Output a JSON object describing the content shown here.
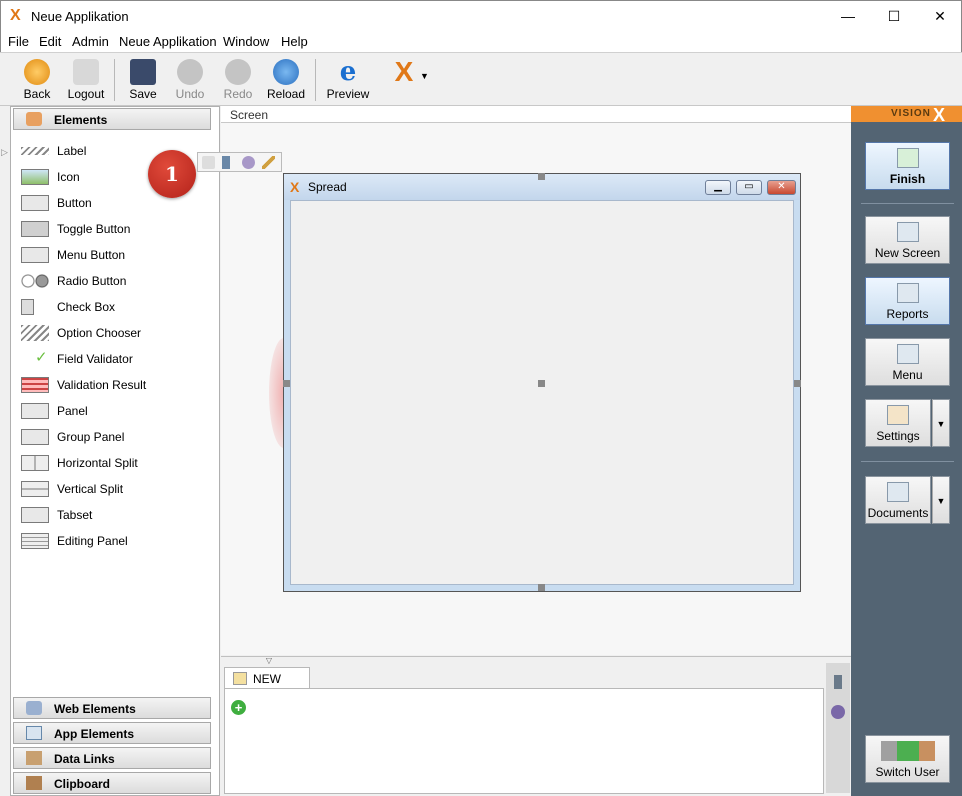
{
  "window": {
    "title": "Neue Applikation",
    "app_icon": "X",
    "minimize": "—",
    "maximize": "☐",
    "close": "✕"
  },
  "menu": [
    "File",
    "Edit",
    "Admin",
    "Neue Applikation",
    "Window",
    "Help"
  ],
  "toolbar": {
    "back": "Back",
    "logout": "Logout",
    "save": "Save",
    "undo": "Undo",
    "redo": "Redo",
    "reload": "Reload",
    "preview": "Preview"
  },
  "left_panel": {
    "header": "Elements",
    "items": [
      "Label",
      "Icon",
      "Button",
      "Toggle Button",
      "Menu Button",
      "Radio Button",
      "Check Box",
      "Option Chooser",
      "Field Validator",
      "Validation Result",
      "Panel",
      "Group Panel",
      "Horizontal Split",
      "Vertical Split",
      "Tabset",
      "Editing Panel"
    ],
    "footer": [
      "Web Elements",
      "App Elements",
      "Data Links",
      "Clipboard"
    ]
  },
  "breadcrumb": "Screen",
  "badge": "1",
  "spread": {
    "title": "Spread",
    "icon": "X"
  },
  "bottom": {
    "tab": "NEW table",
    "add": "+"
  },
  "right_panel": {
    "logo_text": "VISION",
    "logo_x": "X",
    "buttons": {
      "finish": "Finish",
      "new_screen": "New Screen",
      "reports": "Reports",
      "menu": "Menu",
      "settings": "Settings",
      "documents": "Documents",
      "switch_user": "Switch User"
    }
  },
  "colors": {
    "accent": "#e07818",
    "sidebar": "#536473",
    "badge": "#c0392b"
  }
}
